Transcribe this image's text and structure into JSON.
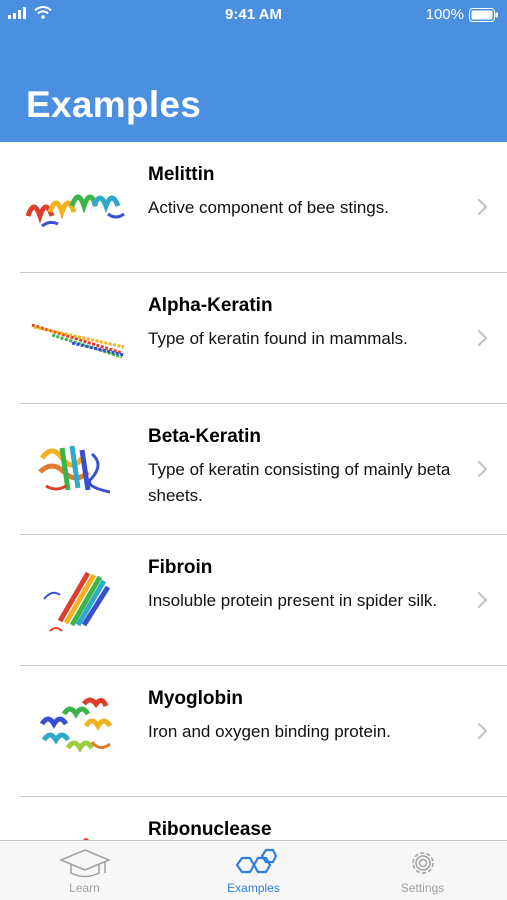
{
  "status": {
    "time": "9:41 AM",
    "battery": "100%"
  },
  "header": {
    "title": "Examples"
  },
  "colors": {
    "accent": "#4a8fe0",
    "tab_inactive": "#a0a0a0"
  },
  "items": [
    {
      "name": "Melittin",
      "description": "Active component of bee stings.",
      "icon": "melittin-structure-thumbnail"
    },
    {
      "name": "Alpha-Keratin",
      "description": "Type of keratin found in mammals.",
      "icon": "alpha-keratin-structure-thumbnail"
    },
    {
      "name": "Beta-Keratin",
      "description": "Type of keratin consisting of mainly beta sheets.",
      "icon": "beta-keratin-structure-thumbnail"
    },
    {
      "name": "Fibroin",
      "description": "Insoluble protein present in spider silk.",
      "icon": "fibroin-structure-thumbnail"
    },
    {
      "name": "Myoglobin",
      "description": "Iron and oxygen binding protein.",
      "icon": "myoglobin-structure-thumbnail"
    },
    {
      "name": "Ribonuclease",
      "description": "",
      "icon": "ribonuclease-structure-thumbnail"
    }
  ],
  "tabs": [
    {
      "label": "Learn",
      "icon": "graduation-cap-icon",
      "active": false
    },
    {
      "label": "Examples",
      "icon": "hexagon-molecule-icon",
      "active": true
    },
    {
      "label": "Settings",
      "icon": "gear-icon",
      "active": false
    }
  ]
}
